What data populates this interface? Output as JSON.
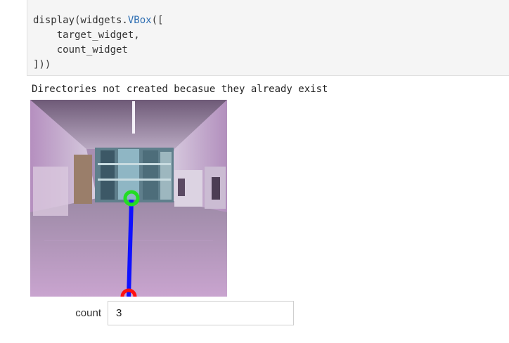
{
  "code_cell": {
    "lines": [
      {
        "prefix": "display(widgets.",
        "attr": "VBox",
        "suffix": "(["
      },
      {
        "text": "    target_widget,"
      },
      {
        "text": "    count_widget"
      },
      {
        "text": "]))"
      }
    ]
  },
  "output": {
    "stdout": "Directories not created becasue they already exist",
    "image": {
      "description_icon": "camera-image-icon",
      "overlay_colors": {
        "target_circle": "#22dd22",
        "path_line": "#1010ff",
        "origin_marker": "#ff1010"
      }
    },
    "count_widget": {
      "label": "count",
      "value": "3"
    }
  },
  "colors": {
    "code_background": "#f5f5f5",
    "code_attr": "#2f6fb3"
  }
}
